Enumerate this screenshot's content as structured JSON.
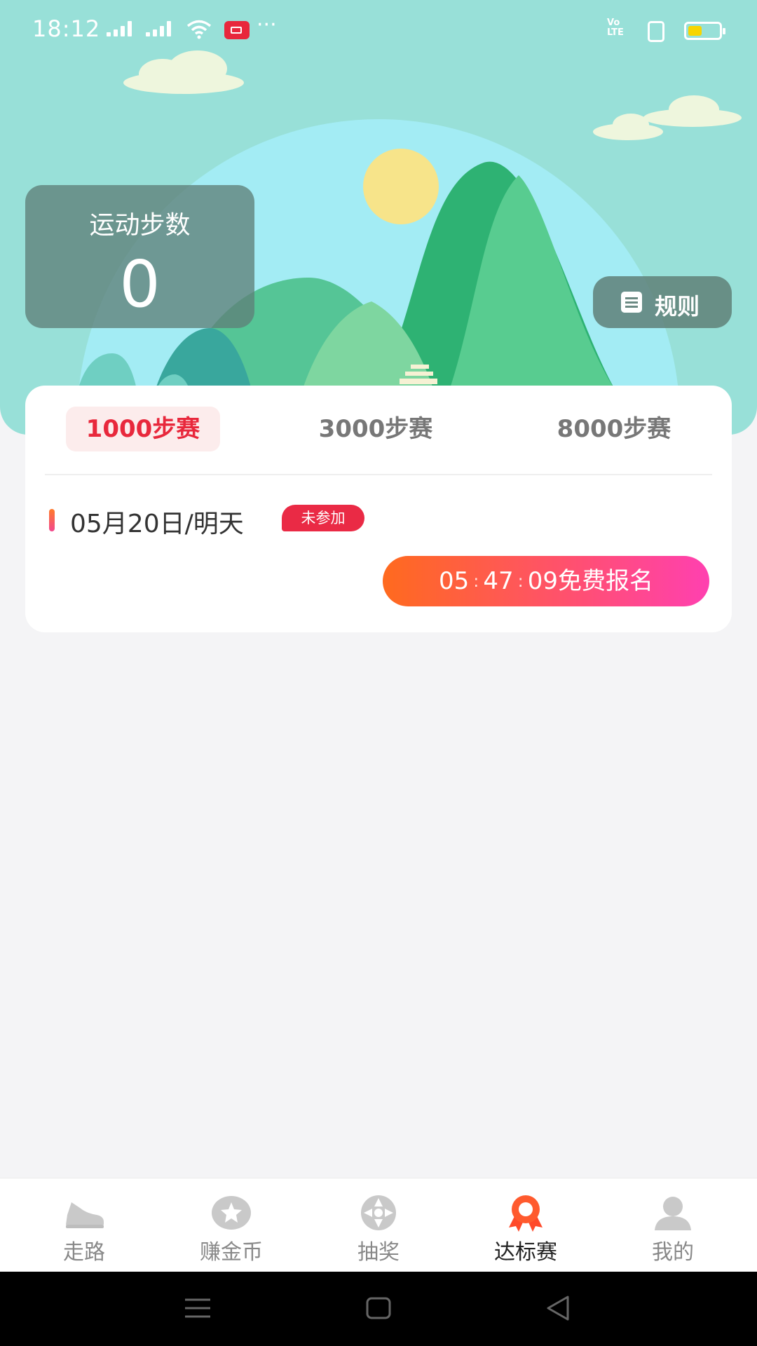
{
  "status_bar": {
    "time": "18:12",
    "signal_icons": [
      "signal-bars-icon",
      "signal-bars-icon",
      "wifi-icon"
    ],
    "notification_icons": [
      "screen-record-icon",
      "more-dots-icon"
    ],
    "more": "···",
    "volte_line1": "Vo",
    "volte_line2": "LTE",
    "right_icons": [
      "volte-icon",
      "vibrate-icon",
      "battery-icon"
    ],
    "battery_level": 0.45,
    "battery_color": "#f8d500"
  },
  "hero": {
    "steps_label": "运动步数",
    "steps_value": "0",
    "rules_label": "规则",
    "rules_icon": "clipboard-icon"
  },
  "race": {
    "tabs": [
      {
        "label": "1000步赛",
        "active": true
      },
      {
        "label": "3000步赛",
        "active": false
      },
      {
        "label": "8000步赛",
        "active": false
      }
    ],
    "date_text": "05月20日/明天",
    "status_badge": "未参加",
    "countdown": {
      "h": "05",
      "m": "47",
      "s": "09",
      "sep": ":"
    },
    "signup_label": "免费报名"
  },
  "tabbar": {
    "items": [
      {
        "label": "走路",
        "icon": "shoe-icon",
        "active": false
      },
      {
        "label": "赚金币",
        "icon": "coin-star-icon",
        "active": false
      },
      {
        "label": "抽奖",
        "icon": "lottery-wheel-icon",
        "active": false
      },
      {
        "label": "达标赛",
        "icon": "medal-ribbon-icon",
        "active": true
      },
      {
        "label": "我的",
        "icon": "user-icon",
        "active": false
      }
    ]
  },
  "system_nav": {
    "icons": [
      "menu-icon",
      "home-icon",
      "back-icon"
    ]
  },
  "colors": {
    "accent": "#e8283c",
    "hero_bg": "#98e0d8",
    "button_gradient_start": "#ff6a1e",
    "button_gradient_end": "#ff40b0"
  }
}
